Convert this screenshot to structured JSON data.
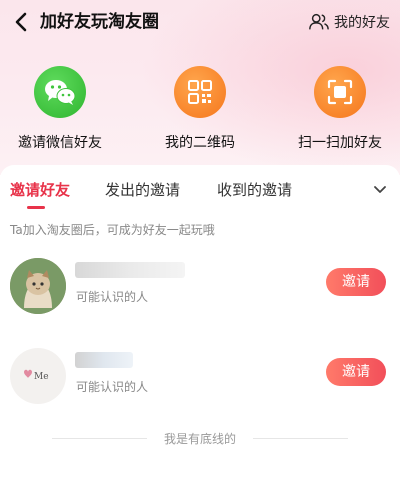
{
  "header": {
    "title": "加好友玩淘友圈",
    "friends_label": "我的好友"
  },
  "actions": [
    {
      "label": "邀请微信好友",
      "icon": "wechat-icon"
    },
    {
      "label": "我的二维码",
      "icon": "qr-code-icon"
    },
    {
      "label": "扫一扫加好友",
      "icon": "scan-icon"
    }
  ],
  "tabs": [
    {
      "label": "邀请好友"
    },
    {
      "label": "发出的邀请"
    },
    {
      "label": "收到的邀请"
    }
  ],
  "hint": "Ta加入淘友圈后，可成为好友一起玩哦",
  "contacts": [
    {
      "subtitle": "可能认识的人",
      "button": "邀请"
    },
    {
      "subtitle": "可能认识的人",
      "button": "邀请",
      "avatar_text": "Me"
    }
  ],
  "footer": "我是有底线的",
  "colors": {
    "accent": "#e8334a",
    "wechat_green": "#2fb52f",
    "orange": "#f5761c"
  }
}
